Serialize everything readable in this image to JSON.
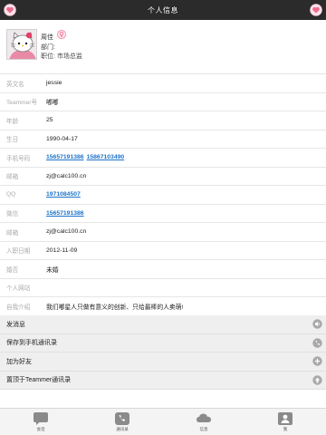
{
  "header": {
    "title": "个人信息",
    "accent": "#f06a8e"
  },
  "profile": {
    "name": "周佳",
    "department": "部门:",
    "position": "职位:   市场总监",
    "gender_icon": "female-gender-icon"
  },
  "fields": [
    {
      "label": "英文名",
      "value": "jessie"
    },
    {
      "label": "Teammer号",
      "value": "嘟嘟"
    },
    {
      "label": "年龄",
      "value": "25"
    },
    {
      "label": "生日",
      "value": "1990-04-17"
    },
    {
      "label": "手机号码",
      "links": [
        "15657191386",
        "15867103490"
      ]
    },
    {
      "label": "邮箱",
      "value": "zj@calc100.cn"
    },
    {
      "label": "QQ",
      "links": [
        "1971084507"
      ]
    },
    {
      "label": "微信",
      "links": [
        "15657191386"
      ]
    },
    {
      "label": "邮箱",
      "value": "zj@calc100.cn"
    },
    {
      "label": "入职日期",
      "value": "2012-11-09"
    },
    {
      "label": "婚否",
      "value": "未婚"
    },
    {
      "label": "个人网站",
      "value": ""
    },
    {
      "label": "自我介绍",
      "value": "我们嘟星人只做有意义的创新、只给最棒的人卖萌!"
    }
  ],
  "actions": [
    {
      "label": "发消息",
      "icon": "speaker-icon"
    },
    {
      "label": "保存到手机通讯录",
      "icon": "phone-icon"
    },
    {
      "label": "加为好友",
      "icon": "add-icon"
    },
    {
      "label": "置顶于Teammer通讯录",
      "icon": "arrow-up-icon"
    }
  ],
  "tabs": [
    {
      "label": "会话",
      "icon": "chat-bubble-icon"
    },
    {
      "label": "通讯录",
      "icon": "phone-contacts-icon"
    },
    {
      "label": "信息",
      "icon": "cloud-icon"
    },
    {
      "label": "我",
      "icon": "user-icon"
    }
  ],
  "colors": {
    "topbar": "#2b2b2b",
    "link": "#1c73c9",
    "label": "#aaaaaa",
    "action_bg": "#efefef"
  }
}
